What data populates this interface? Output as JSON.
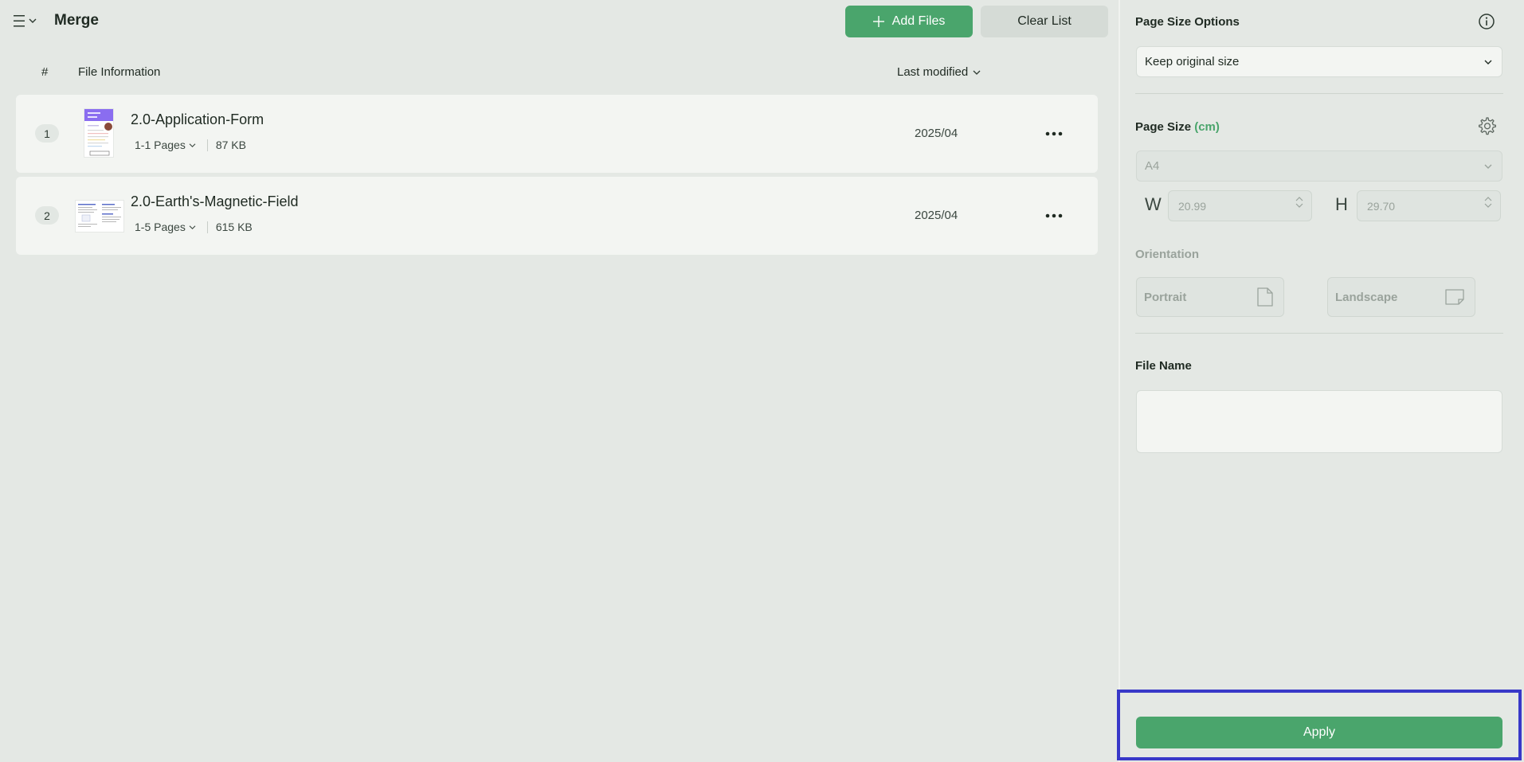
{
  "header": {
    "title": "Merge",
    "add_files_label": "Add Files",
    "clear_list_label": "Clear List"
  },
  "list": {
    "col_number": "#",
    "col_info": "File Information",
    "col_sort": "Last modified",
    "rows": [
      {
        "index": "1",
        "name": "2.0-Application-Form",
        "pages": "1-1 Pages",
        "size": "87 KB",
        "modified": "2025/04"
      },
      {
        "index": "2",
        "name": "2.0-Earth's-Magnetic-Field",
        "pages": "1-5 Pages",
        "size": "615 KB",
        "modified": "2025/04"
      }
    ]
  },
  "panel": {
    "page_size_options_label": "Page Size Options",
    "page_size_option_value": "Keep original size",
    "page_size_label": "Page Size",
    "page_size_unit": "(cm)",
    "paper_value": "A4",
    "width_label": "W",
    "width_value": "20.99",
    "height_label": "H",
    "height_value": "29.70",
    "orientation_label": "Orientation",
    "portrait_label": "Portrait",
    "landscape_label": "Landscape",
    "file_name_label": "File Name",
    "file_name_value": "",
    "apply_label": "Apply"
  },
  "colors": {
    "accent": "#4aa56c",
    "background": "#e4e8e4",
    "highlight_frame": "#3838c8"
  }
}
